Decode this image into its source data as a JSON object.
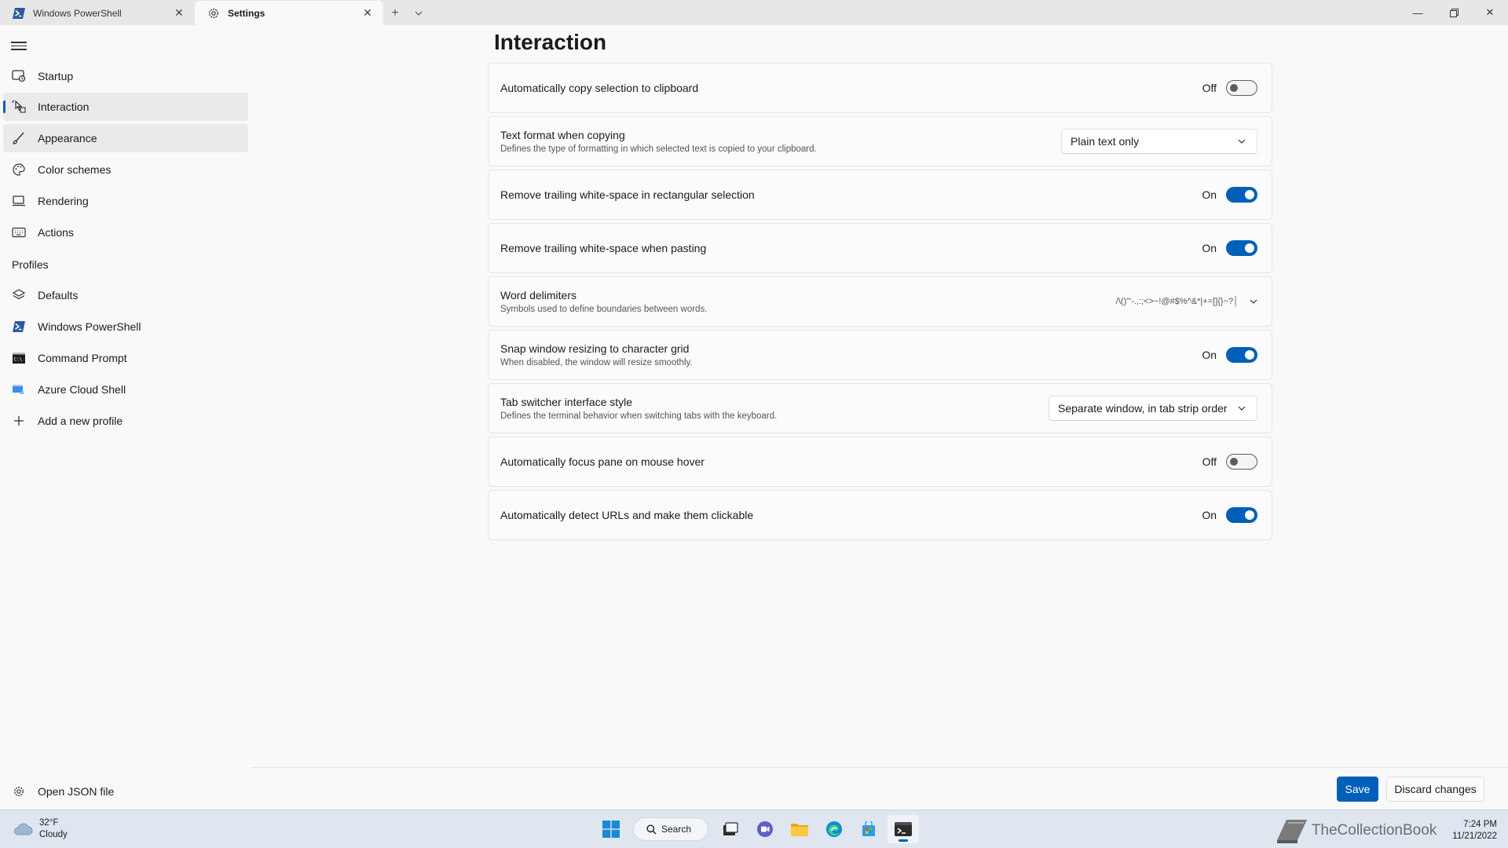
{
  "tabs": [
    {
      "label": "Windows PowerShell",
      "icon": "powershell-icon"
    },
    {
      "label": "Settings",
      "icon": "gear-icon"
    }
  ],
  "sidebar": {
    "items": [
      {
        "label": "Startup",
        "icon": "startup-icon"
      },
      {
        "label": "Interaction",
        "icon": "interaction-icon"
      },
      {
        "label": "Appearance",
        "icon": "brush-icon"
      },
      {
        "label": "Color schemes",
        "icon": "palette-icon"
      },
      {
        "label": "Rendering",
        "icon": "monitor-icon"
      },
      {
        "label": "Actions",
        "icon": "keyboard-icon"
      }
    ],
    "profiles_header": "Profiles",
    "profiles": [
      {
        "label": "Defaults",
        "icon": "layers-icon"
      },
      {
        "label": "Windows PowerShell",
        "icon": "powershell-icon"
      },
      {
        "label": "Command Prompt",
        "icon": "cmd-icon"
      },
      {
        "label": "Azure Cloud Shell",
        "icon": "azure-icon"
      },
      {
        "label": "Add a new profile",
        "icon": "plus-icon"
      }
    ],
    "open_json": "Open JSON file"
  },
  "main": {
    "title": "Interaction",
    "settings": [
      {
        "label": "Automatically copy selection to clipboard",
        "state": "Off"
      },
      {
        "label": "Text format when copying",
        "desc": "Defines the type of formatting in which selected text is copied to your clipboard.",
        "value": "Plain text only"
      },
      {
        "label": "Remove trailing white-space in rectangular selection",
        "state": "On"
      },
      {
        "label": "Remove trailing white-space when pasting",
        "state": "On"
      },
      {
        "label": "Word delimiters",
        "desc": "Symbols used to define boundaries between words.",
        "value": "/\\()\"'-.,:;<>~!@#$%^&*|+=[]{}~?│"
      },
      {
        "label": "Snap window resizing to character grid",
        "desc": "When disabled, the window will resize smoothly.",
        "state": "On"
      },
      {
        "label": "Tab switcher interface style",
        "desc": "Defines the terminal behavior when switching tabs with the keyboard.",
        "value": "Separate window, in tab strip order"
      },
      {
        "label": "Automatically focus pane on mouse hover",
        "state": "Off"
      },
      {
        "label": "Automatically detect URLs and make them clickable",
        "state": "On"
      }
    ]
  },
  "footer": {
    "save": "Save",
    "discard": "Discard changes"
  },
  "taskbar": {
    "temp": "32°F",
    "condition": "Cloudy",
    "search": "Search",
    "time": "7:24 PM",
    "date": "11/21/2022",
    "watermark": "TheCollectionBook"
  },
  "colors": {
    "accent": "#005fb8",
    "background": "#f9f9f9",
    "titlebar": "#e7e7e7"
  }
}
